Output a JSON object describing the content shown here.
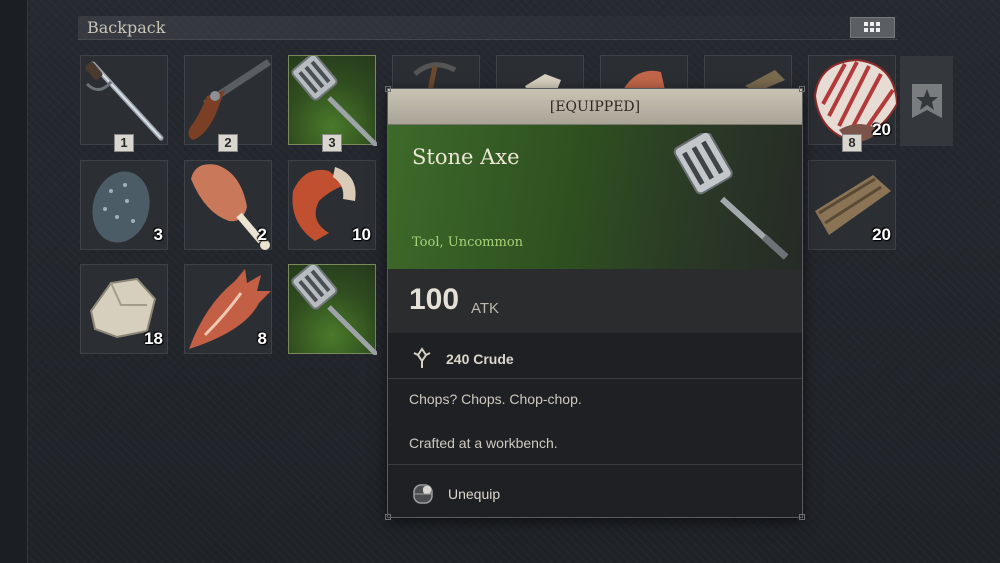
{
  "header": {
    "title": "Backpack"
  },
  "slots": [
    {
      "item": "sword-icon",
      "hotkey": "1"
    },
    {
      "item": "pistol-icon",
      "hotkey": "2"
    },
    {
      "item": "spatula-icon",
      "hotkey": "3",
      "selected": true
    },
    {
      "item": "pickaxe-icon"
    },
    {
      "item": "stone-icon"
    },
    {
      "item": "shell-icon"
    },
    {
      "item": "wood-icon"
    },
    {
      "item": "clam-icon",
      "quantity": "20",
      "hotkey": "8"
    },
    {
      "item": "egg-icon",
      "quantity": "3"
    },
    {
      "item": "drumstick-icon",
      "quantity": "2"
    },
    {
      "item": "crab-claw-icon",
      "quantity": "10"
    },
    {
      "item": "wood-icon",
      "quantity": "20"
    },
    {
      "item": "stone-icon",
      "quantity": "18"
    },
    {
      "item": "shell-icon",
      "quantity": "8"
    },
    {
      "item": "spatula-icon",
      "selected": true
    }
  ],
  "tooltip": {
    "banner": "[EQUIPPED]",
    "name": "Stone Axe",
    "type": "Tool, Uncommon",
    "stat_value": "100",
    "stat_unit": "ATK",
    "cost": "240 Crude",
    "description": "Chops? Chops. Chop-chop.",
    "crafted": "Crafted at a workbench.",
    "action": "Unequip"
  },
  "colors": {
    "uncommon": "#a7d27a",
    "banner": "#c9c3b4"
  }
}
